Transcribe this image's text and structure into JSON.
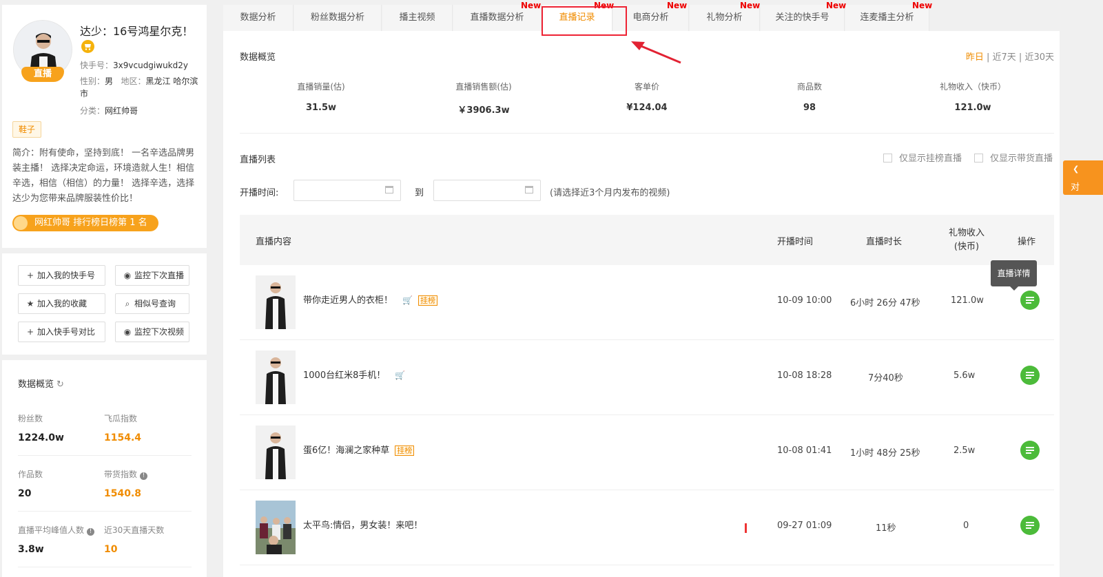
{
  "profile": {
    "name": "达少：16号鸿星尔克！",
    "live_badge": "直播",
    "kuaishou_label": "快手号：",
    "kuaishou_id": "3x9vcudgiwukd2y",
    "gender_label": "性别：",
    "gender": "男",
    "region_label": "地区：",
    "region": "黑龙江 哈尔滨市",
    "category_label": "分类：",
    "category": "网红帅哥",
    "tag": "鞋子",
    "intro": "简介：附有使命，坚持到底！ 一名辛选品牌男装主播！ 选择决定命运，环境造就人生！相信辛选，相信（相信）的力量！ 选择辛选，选择达少为您带来品牌服装性价比！",
    "rank": "网红帅哥 排行榜日榜第 1 名"
  },
  "actions": [
    {
      "label": "加入我的快手号",
      "icon": "plus-icon"
    },
    {
      "label": "监控下次直播",
      "icon": "eye-icon"
    },
    {
      "label": "加入我的收藏",
      "icon": "star-icon"
    },
    {
      "label": "相似号查询",
      "icon": "search-icon"
    },
    {
      "label": "加入快手号对比",
      "icon": "plus-icon"
    },
    {
      "label": "监控下次视频",
      "icon": "eye-icon"
    }
  ],
  "stats": {
    "title": "数据概览",
    "items": [
      {
        "label": "粉丝数",
        "value": "1224.0w"
      },
      {
        "label": "飞瓜指数",
        "value": "1154.4"
      },
      {
        "label": "作品数",
        "value": "20"
      },
      {
        "label": "带货指数",
        "value": "1540.8"
      },
      {
        "label": "直播平均峰值人数",
        "value": "3.8w"
      },
      {
        "label": "近30天直播天数",
        "value": "10"
      }
    ]
  },
  "tabs": [
    {
      "label": "数据分析",
      "new": ""
    },
    {
      "label": "粉丝数据分析",
      "new": ""
    },
    {
      "label": "播主视频",
      "new": ""
    },
    {
      "label": "直播数据分析",
      "new": "New"
    },
    {
      "label": "直播记录",
      "new": "New"
    },
    {
      "label": "电商分析",
      "new": "New"
    },
    {
      "label": "礼物分析",
      "new": "New"
    },
    {
      "label": "关注的快手号",
      "new": "New"
    },
    {
      "label": "连麦播主分析",
      "new": "New"
    }
  ],
  "overview": {
    "title": "数据概览",
    "range": [
      "昨日",
      "近7天",
      "近30天"
    ],
    "items": [
      {
        "label": "直播销量(估)",
        "value": "31.5w"
      },
      {
        "label": "直播销售额(估)",
        "value": "￥3906.3w"
      },
      {
        "label": "客单价",
        "value": "¥124.04"
      },
      {
        "label": "商品数",
        "value": "98"
      },
      {
        "label": "礼物收入（快币）",
        "value": "121.0w"
      }
    ]
  },
  "live_list": {
    "title": "直播列表",
    "filter_hook": "仅显示挂榜直播",
    "filter_goods": "仅显示带货直播",
    "time_label": "开播时间:",
    "to_label": "到",
    "hint": "(请选择近3个月内发布的视频)",
    "columns": [
      "直播内容",
      "开播时间",
      "直播时长",
      "礼物收入\n(快币)",
      "操作"
    ],
    "tooltip": "直播详情",
    "rows": [
      {
        "title": "带你走近男人的衣柜！",
        "cart": true,
        "rank_tag": "挂榜",
        "start": "10-09 10:00",
        "duration": "6小时 26分 47秒",
        "gift": "121.0w"
      },
      {
        "title": "1000台红米8手机！",
        "cart": true,
        "rank_tag": "",
        "start": "10-08 18:28",
        "duration": "7分40秒",
        "gift": "5.6w"
      },
      {
        "title": "蛋6亿！海澜之家种草",
        "cart": false,
        "rank_tag": "挂榜",
        "start": "10-08 01:41",
        "duration": "1小时 48分 25秒",
        "gift": "2.5w"
      },
      {
        "title": "太平鸟:情侣，男女装！来吧！",
        "cart": false,
        "rank_tag": "",
        "start": "09-27 01:09",
        "duration": "11秒",
        "gift": "0"
      }
    ]
  },
  "side_float": {
    "label": "对"
  },
  "colors": {
    "accent": "#f08c00",
    "highlight": "#e22233",
    "detail": "#4cbb3a"
  }
}
